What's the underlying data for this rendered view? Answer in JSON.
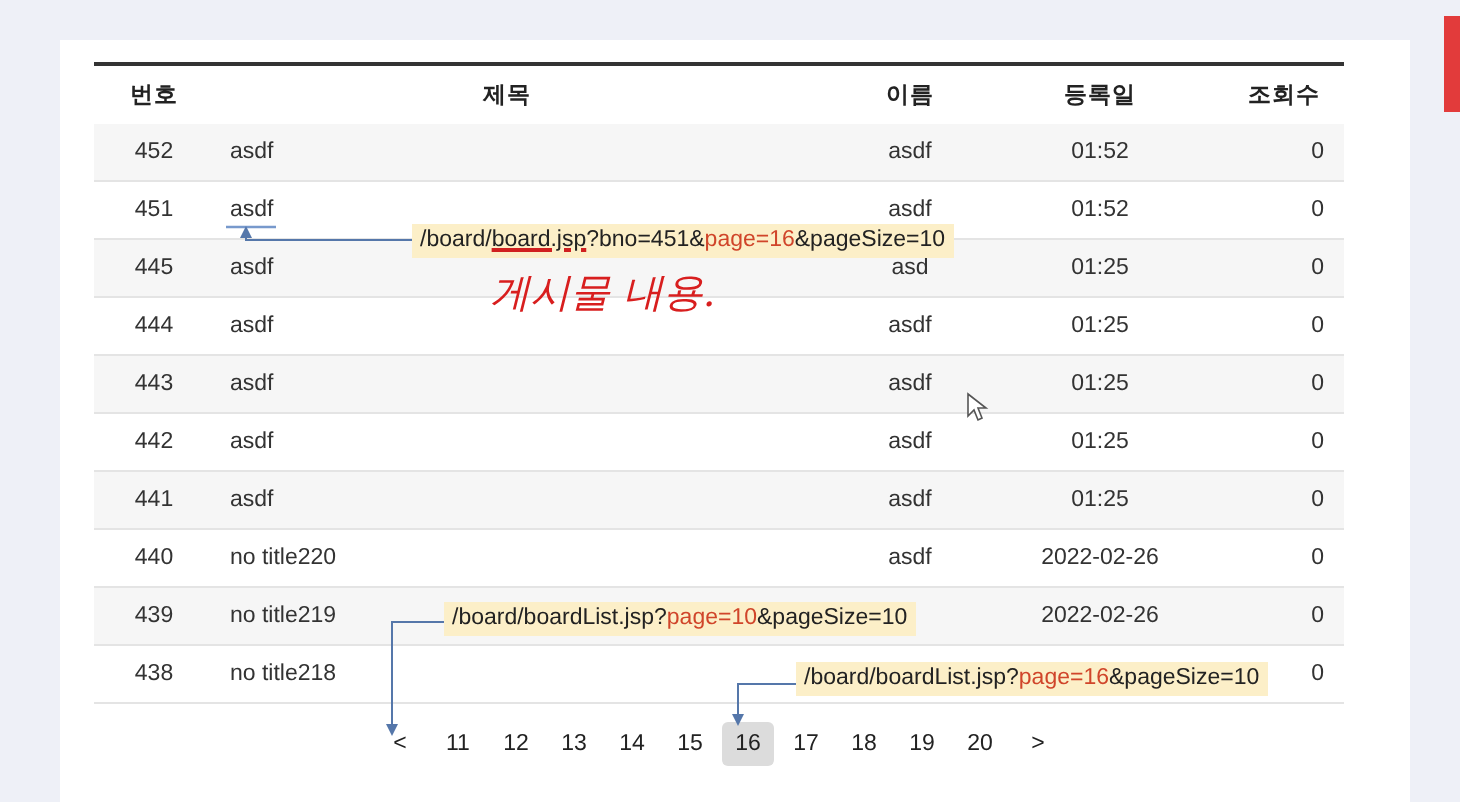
{
  "table": {
    "columns": [
      "번호",
      "제목",
      "이름",
      "등록일",
      "조회수"
    ],
    "rows": [
      {
        "cells": [
          "452",
          "asdf",
          "asdf",
          "01:52",
          "0"
        ]
      },
      {
        "cells": [
          "451",
          "asdf",
          "asdf",
          "01:52",
          "0"
        ]
      },
      {
        "cells": [
          "445",
          "asdf",
          "asd",
          "01:25",
          "0"
        ]
      },
      {
        "cells": [
          "444",
          "asdf",
          "asdf",
          "01:25",
          "0"
        ]
      },
      {
        "cells": [
          "443",
          "asdf",
          "asdf",
          "01:25",
          "0"
        ]
      },
      {
        "cells": [
          "442",
          "asdf",
          "asdf",
          "01:25",
          "0"
        ]
      },
      {
        "cells": [
          "441",
          "asdf",
          "asdf",
          "01:25",
          "0"
        ]
      },
      {
        "cells": [
          "440",
          "no title220",
          "asdf",
          "2022-02-26",
          "0"
        ]
      },
      {
        "cells": [
          "439",
          "no title219",
          null,
          "2022-02-26",
          "0"
        ]
      },
      {
        "cells": [
          "438",
          "no title218",
          null,
          null,
          "0"
        ]
      }
    ]
  },
  "pagination": [
    {
      "label": "<",
      "selected": false
    },
    {
      "label": "11",
      "selected": false
    },
    {
      "label": "12",
      "selected": false
    },
    {
      "label": "13",
      "selected": false
    },
    {
      "label": "14",
      "selected": false
    },
    {
      "label": "15",
      "selected": false
    },
    {
      "label": "16",
      "selected": true
    },
    {
      "label": "17",
      "selected": false
    },
    {
      "label": "18",
      "selected": false
    },
    {
      "label": "19",
      "selected": false
    },
    {
      "label": "20",
      "selected": false
    },
    {
      "label": ">",
      "selected": false
    }
  ],
  "annotations": [
    {
      "kind": "url",
      "parts": [
        {
          "text": "/board/",
          "kind": "plain"
        },
        {
          "text": "board.jsp",
          "kind": "underlined"
        },
        {
          "text": "?bno=451&",
          "kind": "plain"
        },
        {
          "text": "page=16",
          "kind": "param"
        },
        {
          "text": "&pageSize=10",
          "kind": "plain"
        }
      ]
    },
    {
      "kind": "handwriting",
      "text": "게시물 내용."
    },
    {
      "kind": "url",
      "parts": [
        {
          "text": "/board/boardList.jsp?",
          "kind": "plain"
        },
        {
          "text": "page=10",
          "kind": "param"
        },
        {
          "text": "&pageSize=10",
          "kind": "plain"
        }
      ]
    },
    {
      "kind": "url",
      "parts": [
        {
          "text": "/board/boardList.jsp?",
          "kind": "plain"
        },
        {
          "text": "page=16",
          "kind": "param"
        },
        {
          "text": "&pageSize=10",
          "kind": "plain"
        }
      ]
    }
  ]
}
